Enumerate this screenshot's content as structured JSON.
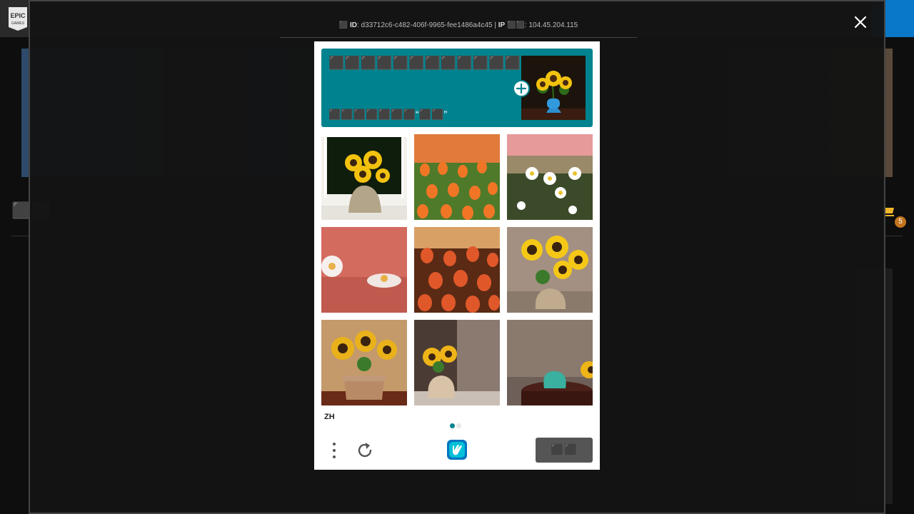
{
  "background_page": {
    "title": "⬛⬛",
    "cart_count": "5",
    "colors": {
      "topbar": "#2a2a2a",
      "accent": "#0a78c8",
      "badge": "#c4741f"
    }
  },
  "overlay": {
    "ray_label": "⬛",
    "id_label": "ID",
    "ray_id": "d33712c6-c482-406f-9965-fee1486a4c45",
    "separator": "|",
    "ip_label": "IP",
    "ip_suffix": "⬛⬛",
    "ip_address": "104.45.204.115"
  },
  "captcha": {
    "prompt_title": "⬛⬛⬛⬛⬛⬛⬛⬛⬛⬛⬛⬛⬛⬛",
    "prompt_subtitle": "⬛⬛⬛⬛⬛⬛⬛“⬛⬛”",
    "example_image": "sunflower-in-blue-pot",
    "tiles": [
      {
        "image": "sunflowers-vase-window"
      },
      {
        "image": "orange-tulips-field"
      },
      {
        "image": "daisies-pink-sky"
      },
      {
        "image": "daisies-pink-blur"
      },
      {
        "image": "orange-tulips-sunset"
      },
      {
        "image": "sunflowers-pot-table"
      },
      {
        "image": "sunflowers-terracotta-pot"
      },
      {
        "image": "sunflowers-small-pot"
      },
      {
        "image": "teal-pot-sunflower-edge"
      }
    ],
    "language": "ZH",
    "page_index": 1,
    "page_count": 2,
    "skip_label": "⬛⬛",
    "colors": {
      "primary": "#00838f",
      "button": "#555555"
    }
  },
  "icons": {
    "close": "close-icon",
    "plus": "plus-icon",
    "menu": "more-vertical-icon",
    "refresh": "refresh-icon",
    "logo": "hcaptcha-logo-icon",
    "cart": "cart-icon"
  }
}
